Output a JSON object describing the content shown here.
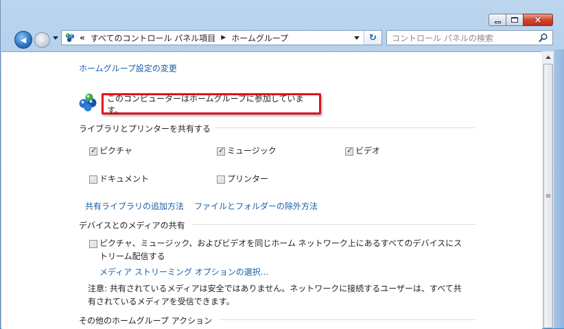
{
  "window": {
    "minimize_label": "Minimize",
    "maximize_label": "Maximize",
    "close_glyph": "×"
  },
  "nav": {
    "back_glyph": "◀",
    "forward_glyph": "▶",
    "address_prefix": "«",
    "breadcrumb": [
      "すべてのコントロール パネル項目",
      "ホームグループ"
    ],
    "breadcrumb_sep": "▶",
    "refresh_glyph": "↻",
    "search_placeholder": "コントロール パネルの検索"
  },
  "content": {
    "change_settings_link": "ホームグループ設定の変更",
    "status_text": "このコンピューターはホームグループに参加しています。",
    "share_section": {
      "heading": "ライブラリとプリンターを共有する",
      "items": [
        {
          "label": "ピクチャ",
          "checked": true
        },
        {
          "label": "ミュージック",
          "checked": true
        },
        {
          "label": "ビデオ",
          "checked": true
        },
        {
          "label": "ドキュメント",
          "checked": false
        },
        {
          "label": "プリンター",
          "checked": false
        }
      ],
      "link_add_library": "共有ライブラリの追加方法",
      "link_exclude": "ファイルとフォルダーの除外方法"
    },
    "media_section": {
      "heading": "デバイスとのメディアの共有",
      "stream_label_line1": "ピクチャ、ミュージック、およびビデオを同じホーム ネットワーク上にあるすべてのデバイスにス",
      "stream_label_line2": "トリーム配信する",
      "stream_checked": false,
      "streaming_options_link": "メディア ストリーミング オプションの選択...",
      "note_line1": "注意: 共有されているメディアは安全ではありません。ネットワークに接続するユーザーは、すべて共",
      "note_line2": "有されているメディアを受信できます。"
    },
    "other_section": {
      "heading": "その他のホームグループ アクション"
    }
  },
  "scrollbar": {
    "grip_glyph": "≡"
  },
  "colors": {
    "link": "#1a5ea8",
    "highlight_border": "#e0121a",
    "close_button": "#c8361f"
  }
}
